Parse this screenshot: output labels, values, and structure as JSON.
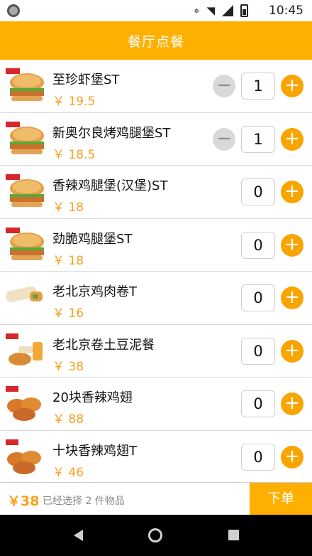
{
  "status_bar": {
    "time": "10:45"
  },
  "app_bar": {
    "title": "餐厅点餐"
  },
  "items": [
    {
      "name": "至珍虾堡ST",
      "price": "￥ 19.5",
      "qty": "1",
      "has_minus": true,
      "thumb": "burger"
    },
    {
      "name": "新奥尔良烤鸡腿堡ST",
      "price": "￥ 18.5",
      "qty": "1",
      "has_minus": true,
      "thumb": "burger"
    },
    {
      "name": "香辣鸡腿堡(汉堡)ST",
      "price": "￥ 18",
      "qty": "0",
      "has_minus": false,
      "thumb": "burger"
    },
    {
      "name": "劲脆鸡腿堡ST",
      "price": "￥ 18",
      "qty": "0",
      "has_minus": false,
      "thumb": "burger"
    },
    {
      "name": "老北京鸡肉卷T",
      "price": "￥ 16",
      "qty": "0",
      "has_minus": false,
      "thumb": "wrap"
    },
    {
      "name": "老北京卷土豆泥餐",
      "price": "￥ 38",
      "qty": "0",
      "has_minus": false,
      "thumb": "meal"
    },
    {
      "name": "20块香辣鸡翅",
      "price": "￥ 88",
      "qty": "0",
      "has_minus": false,
      "thumb": "wings"
    },
    {
      "name": "十块香辣鸡翅T",
      "price": "￥ 46",
      "qty": "0",
      "has_minus": false,
      "thumb": "wings"
    }
  ],
  "controls": {
    "minus_symbol": "−",
    "plus_symbol": "+"
  },
  "footer": {
    "total": "￥38",
    "summary": "已经选择 2 件物品",
    "order_label": "下单"
  },
  "colors": {
    "accent": "#fdb000",
    "price": "#f7a020",
    "minus": "#d9d9d9"
  }
}
